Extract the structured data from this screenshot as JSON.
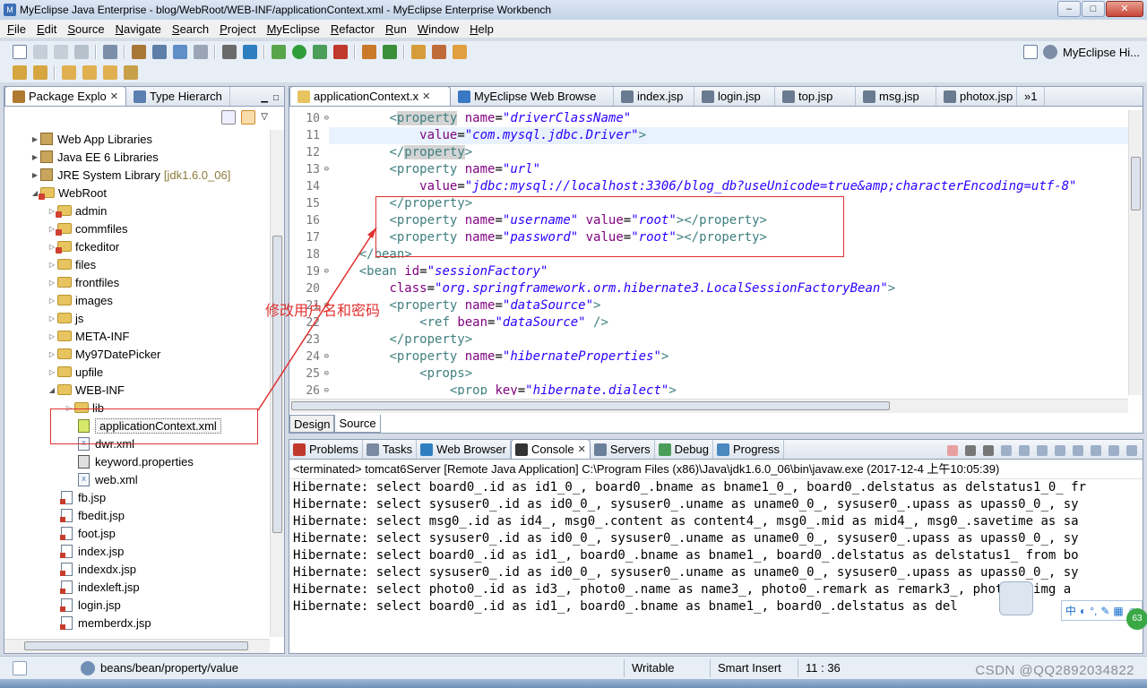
{
  "window": {
    "title": "MyEclipse Java Enterprise - blog/WebRoot/WEB-INF/applicationContext.xml - MyEclipse Enterprise Workbench",
    "min": "–",
    "max": "□",
    "close": "✕"
  },
  "menu": [
    "File",
    "Edit",
    "Source",
    "Navigate",
    "Search",
    "Project",
    "MyEclipse",
    "Refactor",
    "Run",
    "Window",
    "Help"
  ],
  "perspective": {
    "label": "MyEclipse Hi..."
  },
  "explorer": {
    "tabs": [
      {
        "label": "Package Explo"
      },
      {
        "label": "Type Hierarch"
      }
    ],
    "items": [
      {
        "indent": 0,
        "twisty": "▶",
        "kind": "lib",
        "label": "Web App Libraries"
      },
      {
        "indent": 0,
        "twisty": "▶",
        "kind": "lib",
        "label": "Java EE 6 Libraries"
      },
      {
        "indent": 0,
        "twisty": "▶",
        "kind": "lib",
        "label": "JRE System Library",
        "suffix": "[jdk1.6.0_06]"
      },
      {
        "indent": 0,
        "twisty": "◢",
        "kind": "pkgfolder",
        "label": "WebRoot"
      },
      {
        "indent": 1,
        "twisty": "▷",
        "kind": "pkgfolder",
        "label": "admin"
      },
      {
        "indent": 1,
        "twisty": "▷",
        "kind": "pkgfolder",
        "label": "commfiles"
      },
      {
        "indent": 1,
        "twisty": "▷",
        "kind": "pkgfolder",
        "label": "fckeditor"
      },
      {
        "indent": 1,
        "twisty": "▷",
        "kind": "folder",
        "label": "files"
      },
      {
        "indent": 1,
        "twisty": "▷",
        "kind": "folder",
        "label": "frontfiles"
      },
      {
        "indent": 1,
        "twisty": "▷",
        "kind": "folder",
        "label": "images"
      },
      {
        "indent": 1,
        "twisty": "▷",
        "kind": "folder",
        "label": "js"
      },
      {
        "indent": 1,
        "twisty": "▷",
        "kind": "folder",
        "label": "META-INF"
      },
      {
        "indent": 1,
        "twisty": "▷",
        "kind": "folder",
        "label": "My97DatePicker"
      },
      {
        "indent": 1,
        "twisty": "▷",
        "kind": "folder",
        "label": "upfile"
      },
      {
        "indent": 1,
        "twisty": "◢",
        "kind": "folder",
        "label": "WEB-INF"
      },
      {
        "indent": 2,
        "twisty": "▷",
        "kind": "folder",
        "label": "lib"
      },
      {
        "indent": 2,
        "twisty": "",
        "kind": "xmlspring",
        "label": "applicationContext.xml",
        "selected": true
      },
      {
        "indent": 2,
        "twisty": "",
        "kind": "xml",
        "label": "dwr.xml"
      },
      {
        "indent": 2,
        "twisty": "",
        "kind": "props",
        "label": "keyword.properties"
      },
      {
        "indent": 2,
        "twisty": "",
        "kind": "xml",
        "label": "web.xml"
      },
      {
        "indent": 1,
        "twisty": "",
        "kind": "jsp",
        "label": "fb.jsp"
      },
      {
        "indent": 1,
        "twisty": "",
        "kind": "jsp",
        "label": "fbedit.jsp"
      },
      {
        "indent": 1,
        "twisty": "",
        "kind": "jsp",
        "label": "foot.jsp"
      },
      {
        "indent": 1,
        "twisty": "",
        "kind": "jsp",
        "label": "index.jsp"
      },
      {
        "indent": 1,
        "twisty": "",
        "kind": "jsp",
        "label": "indexdx.jsp"
      },
      {
        "indent": 1,
        "twisty": "",
        "kind": "jsp",
        "label": "indexleft.jsp"
      },
      {
        "indent": 1,
        "twisty": "",
        "kind": "jsp",
        "label": "login.jsp"
      },
      {
        "indent": 1,
        "twisty": "",
        "kind": "jsp",
        "label": "memberdx.jsp"
      }
    ]
  },
  "editor": {
    "tabs": [
      {
        "label": "applicationContext.x",
        "active": true,
        "close": "✕"
      },
      {
        "label": "MyEclipse Web Browse"
      },
      {
        "label": "index.jsp"
      },
      {
        "label": "login.jsp"
      },
      {
        "label": "top.jsp"
      },
      {
        "label": "msg.jsp"
      },
      {
        "label": "photox.jsp"
      },
      {
        "label": "»1"
      }
    ],
    "lines": [
      {
        "num": "10",
        "fold": "⊖",
        "segs": [
          [
            "",
            "        "
          ],
          [
            "tag",
            "<"
          ],
          [
            "tag hl",
            "property"
          ],
          [
            "",
            " "
          ],
          [
            "attr",
            "name"
          ],
          [
            "",
            "="
          ],
          [
            "val",
            "\"driverClassName\""
          ]
        ]
      },
      {
        "num": "11",
        "current": true,
        "segs": [
          [
            "",
            "            "
          ],
          [
            "attr",
            "value"
          ],
          [
            "",
            "="
          ],
          [
            "val",
            "\"com.mysql.jdbc.Driver\""
          ],
          [
            "tag",
            ">"
          ]
        ]
      },
      {
        "num": "12",
        "segs": [
          [
            "",
            "        "
          ],
          [
            "tag",
            "</"
          ],
          [
            "tag hl",
            "property"
          ],
          [
            "tag",
            ">"
          ]
        ]
      },
      {
        "num": "13",
        "fold": "⊖",
        "segs": [
          [
            "",
            "        "
          ],
          [
            "tag",
            "<property "
          ],
          [
            "attr",
            "name"
          ],
          [
            "",
            "="
          ],
          [
            "val",
            "\"url\""
          ]
        ]
      },
      {
        "num": "14",
        "segs": [
          [
            "",
            "            "
          ],
          [
            "attr",
            "value"
          ],
          [
            "",
            "="
          ],
          [
            "val",
            "\"jdbc:mysql://localhost:3306/blog_db?useUnicode=true&amp;characterEncoding=utf-8\""
          ]
        ]
      },
      {
        "num": "15",
        "segs": [
          [
            "",
            "        "
          ],
          [
            "tag",
            "</property>"
          ]
        ]
      },
      {
        "num": "16",
        "segs": [
          [
            "",
            "        "
          ],
          [
            "tag",
            "<property "
          ],
          [
            "attr",
            "name"
          ],
          [
            "",
            "="
          ],
          [
            "val",
            "\"username\""
          ],
          [
            "",
            " "
          ],
          [
            "attr",
            "value"
          ],
          [
            "",
            "="
          ],
          [
            "val",
            "\"root\""
          ],
          [
            "tag",
            "></property>"
          ]
        ]
      },
      {
        "num": "17",
        "segs": [
          [
            "",
            "        "
          ],
          [
            "tag",
            "<property "
          ],
          [
            "attr",
            "name"
          ],
          [
            "",
            "="
          ],
          [
            "val",
            "\"password\""
          ],
          [
            "",
            " "
          ],
          [
            "attr",
            "value"
          ],
          [
            "",
            "="
          ],
          [
            "val",
            "\"root\""
          ],
          [
            "tag",
            "></property>"
          ]
        ]
      },
      {
        "num": "18",
        "segs": [
          [
            "",
            "    "
          ],
          [
            "tag",
            "</bean>"
          ]
        ]
      },
      {
        "num": "19",
        "fold": "⊖",
        "segs": [
          [
            "",
            "    "
          ],
          [
            "tag",
            "<bean "
          ],
          [
            "attr",
            "id"
          ],
          [
            "",
            "="
          ],
          [
            "val",
            "\"sessionFactory\""
          ]
        ]
      },
      {
        "num": "20",
        "segs": [
          [
            "",
            "        "
          ],
          [
            "attr",
            "class"
          ],
          [
            "",
            "="
          ],
          [
            "val",
            "\"org.springframework.orm.hibernate3.LocalSessionFactoryBean\""
          ],
          [
            "tag",
            ">"
          ]
        ]
      },
      {
        "num": "21",
        "fold": "⊖",
        "segs": [
          [
            "",
            "        "
          ],
          [
            "tag",
            "<property "
          ],
          [
            "attr",
            "name"
          ],
          [
            "",
            "="
          ],
          [
            "val",
            "\"dataSource\""
          ],
          [
            "tag",
            ">"
          ]
        ]
      },
      {
        "num": "22",
        "segs": [
          [
            "",
            "            "
          ],
          [
            "tag",
            "<ref "
          ],
          [
            "attr",
            "bean"
          ],
          [
            "",
            "="
          ],
          [
            "val",
            "\"dataSource\""
          ],
          [
            "tag",
            " />"
          ]
        ]
      },
      {
        "num": "23",
        "segs": [
          [
            "",
            "        "
          ],
          [
            "tag",
            "</property>"
          ]
        ]
      },
      {
        "num": "24",
        "fold": "⊖",
        "segs": [
          [
            "",
            "        "
          ],
          [
            "tag",
            "<property "
          ],
          [
            "attr",
            "name"
          ],
          [
            "",
            "="
          ],
          [
            "val",
            "\"hibernateProperties\""
          ],
          [
            "tag",
            ">"
          ]
        ]
      },
      {
        "num": "25",
        "fold": "⊖",
        "segs": [
          [
            "",
            "            "
          ],
          [
            "tag",
            "<props>"
          ]
        ]
      },
      {
        "num": "26",
        "fold": "⊖",
        "segs": [
          [
            "",
            "                "
          ],
          [
            "tag",
            "<prop "
          ],
          [
            "attr",
            "key"
          ],
          [
            "",
            "="
          ],
          [
            "val",
            "\"hibernate.dialect\""
          ],
          [
            "tag",
            ">"
          ]
        ]
      }
    ],
    "bottom_tabs": [
      {
        "label": "Design"
      },
      {
        "label": "Source",
        "active": true
      }
    ]
  },
  "annotation": {
    "text": "修改用户名和密码",
    "color": "#e0302e"
  },
  "console": {
    "tabs": [
      {
        "label": "Problems"
      },
      {
        "label": "Tasks"
      },
      {
        "label": "Web Browser"
      },
      {
        "label": "Console",
        "active": true,
        "close": "✕"
      },
      {
        "label": "Servers"
      },
      {
        "label": "Debug"
      },
      {
        "label": "Progress"
      }
    ],
    "header": "<terminated> tomcat6Server [Remote Java Application] C:\\Program Files (x86)\\Java\\jdk1.6.0_06\\bin\\javaw.exe (2017-12-4 上午10:05:39)",
    "lines": [
      "Hibernate: select board0_.id as id1_0_, board0_.bname as bname1_0_, board0_.delstatus as delstatus1_0_ fr",
      "Hibernate: select sysuser0_.id as id0_0_, sysuser0_.uname as uname0_0_, sysuser0_.upass as upass0_0_, sy",
      "Hibernate: select msg0_.id as id4_, msg0_.content as content4_, msg0_.mid as mid4_, msg0_.savetime as sa",
      "Hibernate: select sysuser0_.id as id0_0_, sysuser0_.uname as uname0_0_, sysuser0_.upass as upass0_0_, sy",
      "Hibernate: select board0_.id as id1_, board0_.bname as bname1_, board0_.delstatus as delstatus1_ from bo",
      "Hibernate: select sysuser0_.id as id0_0_, sysuser0_.uname as uname0_0_, sysuser0_.upass as upass0_0_, sy",
      "Hibernate: select photo0_.id as id3_, photo0_.name as name3_, photo0_.remark as remark3_, photo0_.img a",
      "Hibernate: select board0_.id as id1_, board0_.bname as bname1_, board0_.delstatus as del"
    ],
    "ime_label": "中",
    "badge": "63"
  },
  "status": {
    "path": "beans/bean/property/value",
    "writable": "Writable",
    "insert": "Smart Insert",
    "position": "11 : 36"
  },
  "watermark": "CSDN @QQ2892034822",
  "colors": {
    "accent": "#e0302e",
    "tag": "#3f7f7f",
    "attr": "#7f007f",
    "value": "#2a00ff"
  }
}
